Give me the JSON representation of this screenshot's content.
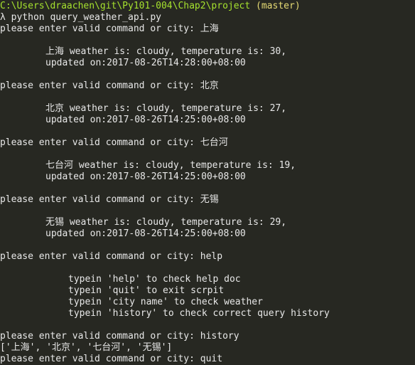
{
  "colors": {
    "background": "#272822",
    "text": "#e8e8e8",
    "path": "#a6e22e",
    "branch": "#e6db74"
  },
  "prompt": {
    "path": "C:\\Users\\draachen\\git\\Py101-004\\Chap2\\project",
    "branch": "(master)",
    "command": "λ python query_weather_api.py"
  },
  "session": {
    "q1": {
      "input": "please enter valid command or city: 上海",
      "line1": "上海 weather is: cloudy, temperature is: 30,",
      "line2": "updated on:2017-08-26T14:28:00+08:00"
    },
    "q2": {
      "input": "please enter valid command or city: 北京",
      "line1": "北京 weather is: cloudy, temperature is: 27,",
      "line2": "updated on:2017-08-26T14:25:00+08:00"
    },
    "q3": {
      "input": "please enter valid command or city: 七台河",
      "line1": "七台河 weather is: cloudy, temperature is: 19,",
      "line2": "updated on:2017-08-26T14:25:00+08:00"
    },
    "q4": {
      "input": "please enter valid command or city: 无锡",
      "line1": "无锡 weather is: cloudy, temperature is: 29,",
      "line2": "updated on:2017-08-26T14:25:00+08:00"
    },
    "help": {
      "input": "please enter valid command or city: help",
      "l1": "typein 'help' to check help doc",
      "l2": "typein 'quit' to exit scrpit",
      "l3": "typein 'city name' to check weather",
      "l4": "typein 'history' to check correct query history"
    },
    "history": {
      "input": "please enter valid command or city: history",
      "output": "['上海', '北京', '七台河', '无锡']"
    },
    "quit": {
      "input": "please enter valid command or city: quit"
    }
  }
}
